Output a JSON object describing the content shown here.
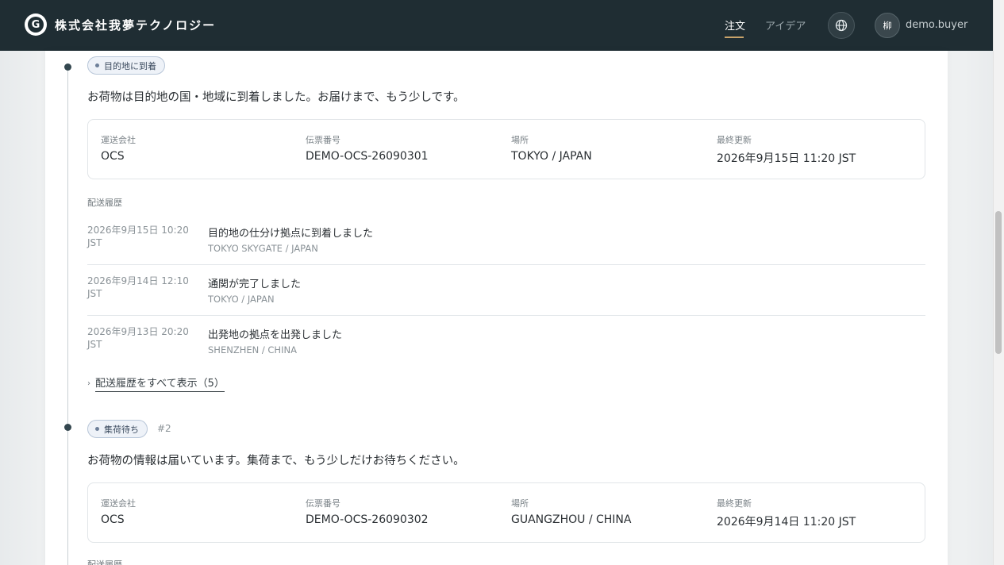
{
  "header": {
    "logo_letter": "G",
    "company": "株式会社我夢テクノロジー",
    "nav_order": "注文",
    "nav_idea": "アイデア",
    "avatar_text": "柳",
    "username": "demo.buyer"
  },
  "shipments": [
    {
      "status": "目的地に到着",
      "number": "",
      "headline": "お荷物は目的地の国・地域に到着しました。お届けまで、もう少しです。",
      "info": {
        "carrier_label": "運送会社",
        "carrier": "OCS",
        "tracking_label": "伝票番号",
        "tracking": "DEMO-OCS-26090301",
        "location_label": "場所",
        "location": "TOKYO / JAPAN",
        "updated_label": "最終更新",
        "updated": "2026年9月15日 11:20 JST"
      },
      "history_label": "配送履歴",
      "events": [
        {
          "date": "2026年9月15日 10:20",
          "tz": "JST",
          "title": "目的地の仕分け拠点に到着しました",
          "loc": "TOKYO SKYGATE / JAPAN"
        },
        {
          "date": "2026年9月14日 12:10",
          "tz": "JST",
          "title": "通関が完了しました",
          "loc": "TOKYO / JAPAN"
        },
        {
          "date": "2026年9月13日 20:20",
          "tz": "JST",
          "title": "出発地の拠点を出発しました",
          "loc": "SHENZHEN / CHINA"
        }
      ],
      "show_all": "配送履歴をすべて表示（5）"
    },
    {
      "status": "集荷待ち",
      "number": "#2",
      "headline": "お荷物の情報は届いています。集荷まで、もう少しだけお待ちください。",
      "info": {
        "carrier_label": "運送会社",
        "carrier": "OCS",
        "tracking_label": "伝票番号",
        "tracking": "DEMO-OCS-26090302",
        "location_label": "場所",
        "location": "GUANGZHOU / CHINA",
        "updated_label": "最終更新",
        "updated": "2026年9月14日 11:20 JST"
      },
      "history_label": "配送履歴"
    }
  ],
  "icons": {
    "logo": "company-logo-icon",
    "globe": "globe-icon",
    "chevron": "chevron-right-icon"
  },
  "colors": {
    "header_bg": "#1f2d33",
    "accent": "#c9a36a",
    "badge_bg": "#eef2f8"
  }
}
